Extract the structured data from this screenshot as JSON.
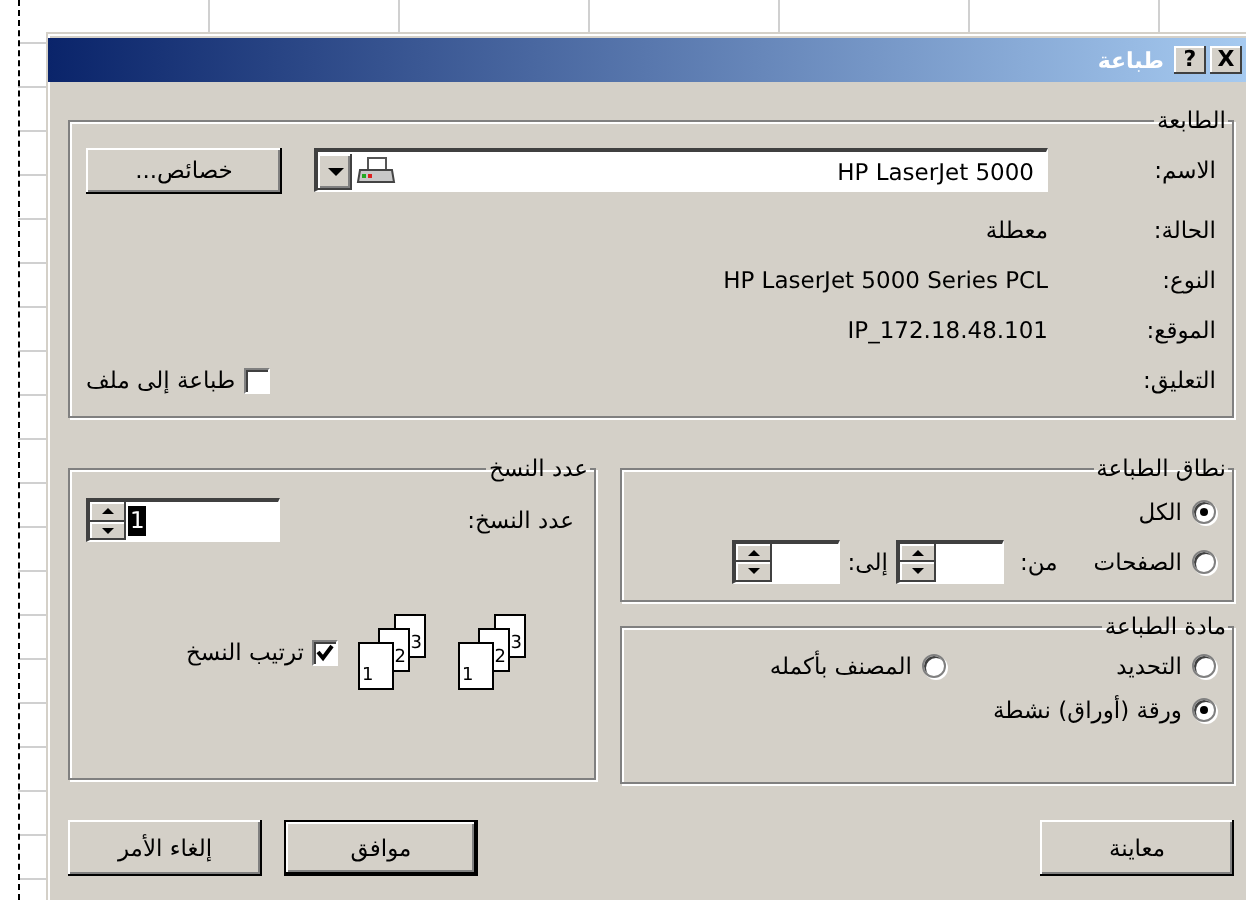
{
  "window": {
    "title": "طباعة",
    "help_button": "?",
    "close_button": "X"
  },
  "printer": {
    "legend": "الطابعة",
    "name_label": "الاسم:",
    "name": "HP LaserJet 5000",
    "properties_button": "خصائص...",
    "fields": [
      {
        "label": "الحالة:",
        "value": "معطلة"
      },
      {
        "label": "النوع:",
        "value": "HP LaserJet 5000 Series PCL"
      },
      {
        "label": "الموقع:",
        "value": "IP_172.18.48.101"
      }
    ],
    "comment_label": "التعليق:",
    "print_to_file": {
      "label": "طباعة إلى ملف",
      "checked": false
    }
  },
  "print_range": {
    "legend": "نطاق الطباعة",
    "options": [
      {
        "label": "الكل",
        "selected": true
      },
      {
        "label": "الصفحات",
        "selected": false
      }
    ],
    "from_label": "من:",
    "to_label": "إلى:"
  },
  "copies": {
    "legend": "عدد النسخ",
    "label": "عدد النسخ:",
    "value": "1",
    "collate": {
      "label": "ترتيب النسخ",
      "checked": true
    },
    "stacks": [
      [
        "3",
        "2",
        "1"
      ],
      [
        "3",
        "2",
        "1"
      ]
    ]
  },
  "print_what": {
    "legend": "مادة الطباعة",
    "options": [
      {
        "label": "التحديد",
        "selected": false
      },
      {
        "label": "المصنف بأكمله",
        "selected": false
      },
      {
        "label": "ورقة (أوراق) نشطة",
        "selected": true
      }
    ]
  },
  "buttons": {
    "preview": "معاينة",
    "ok": "موافق",
    "cancel": "إلغاء الأمر"
  }
}
